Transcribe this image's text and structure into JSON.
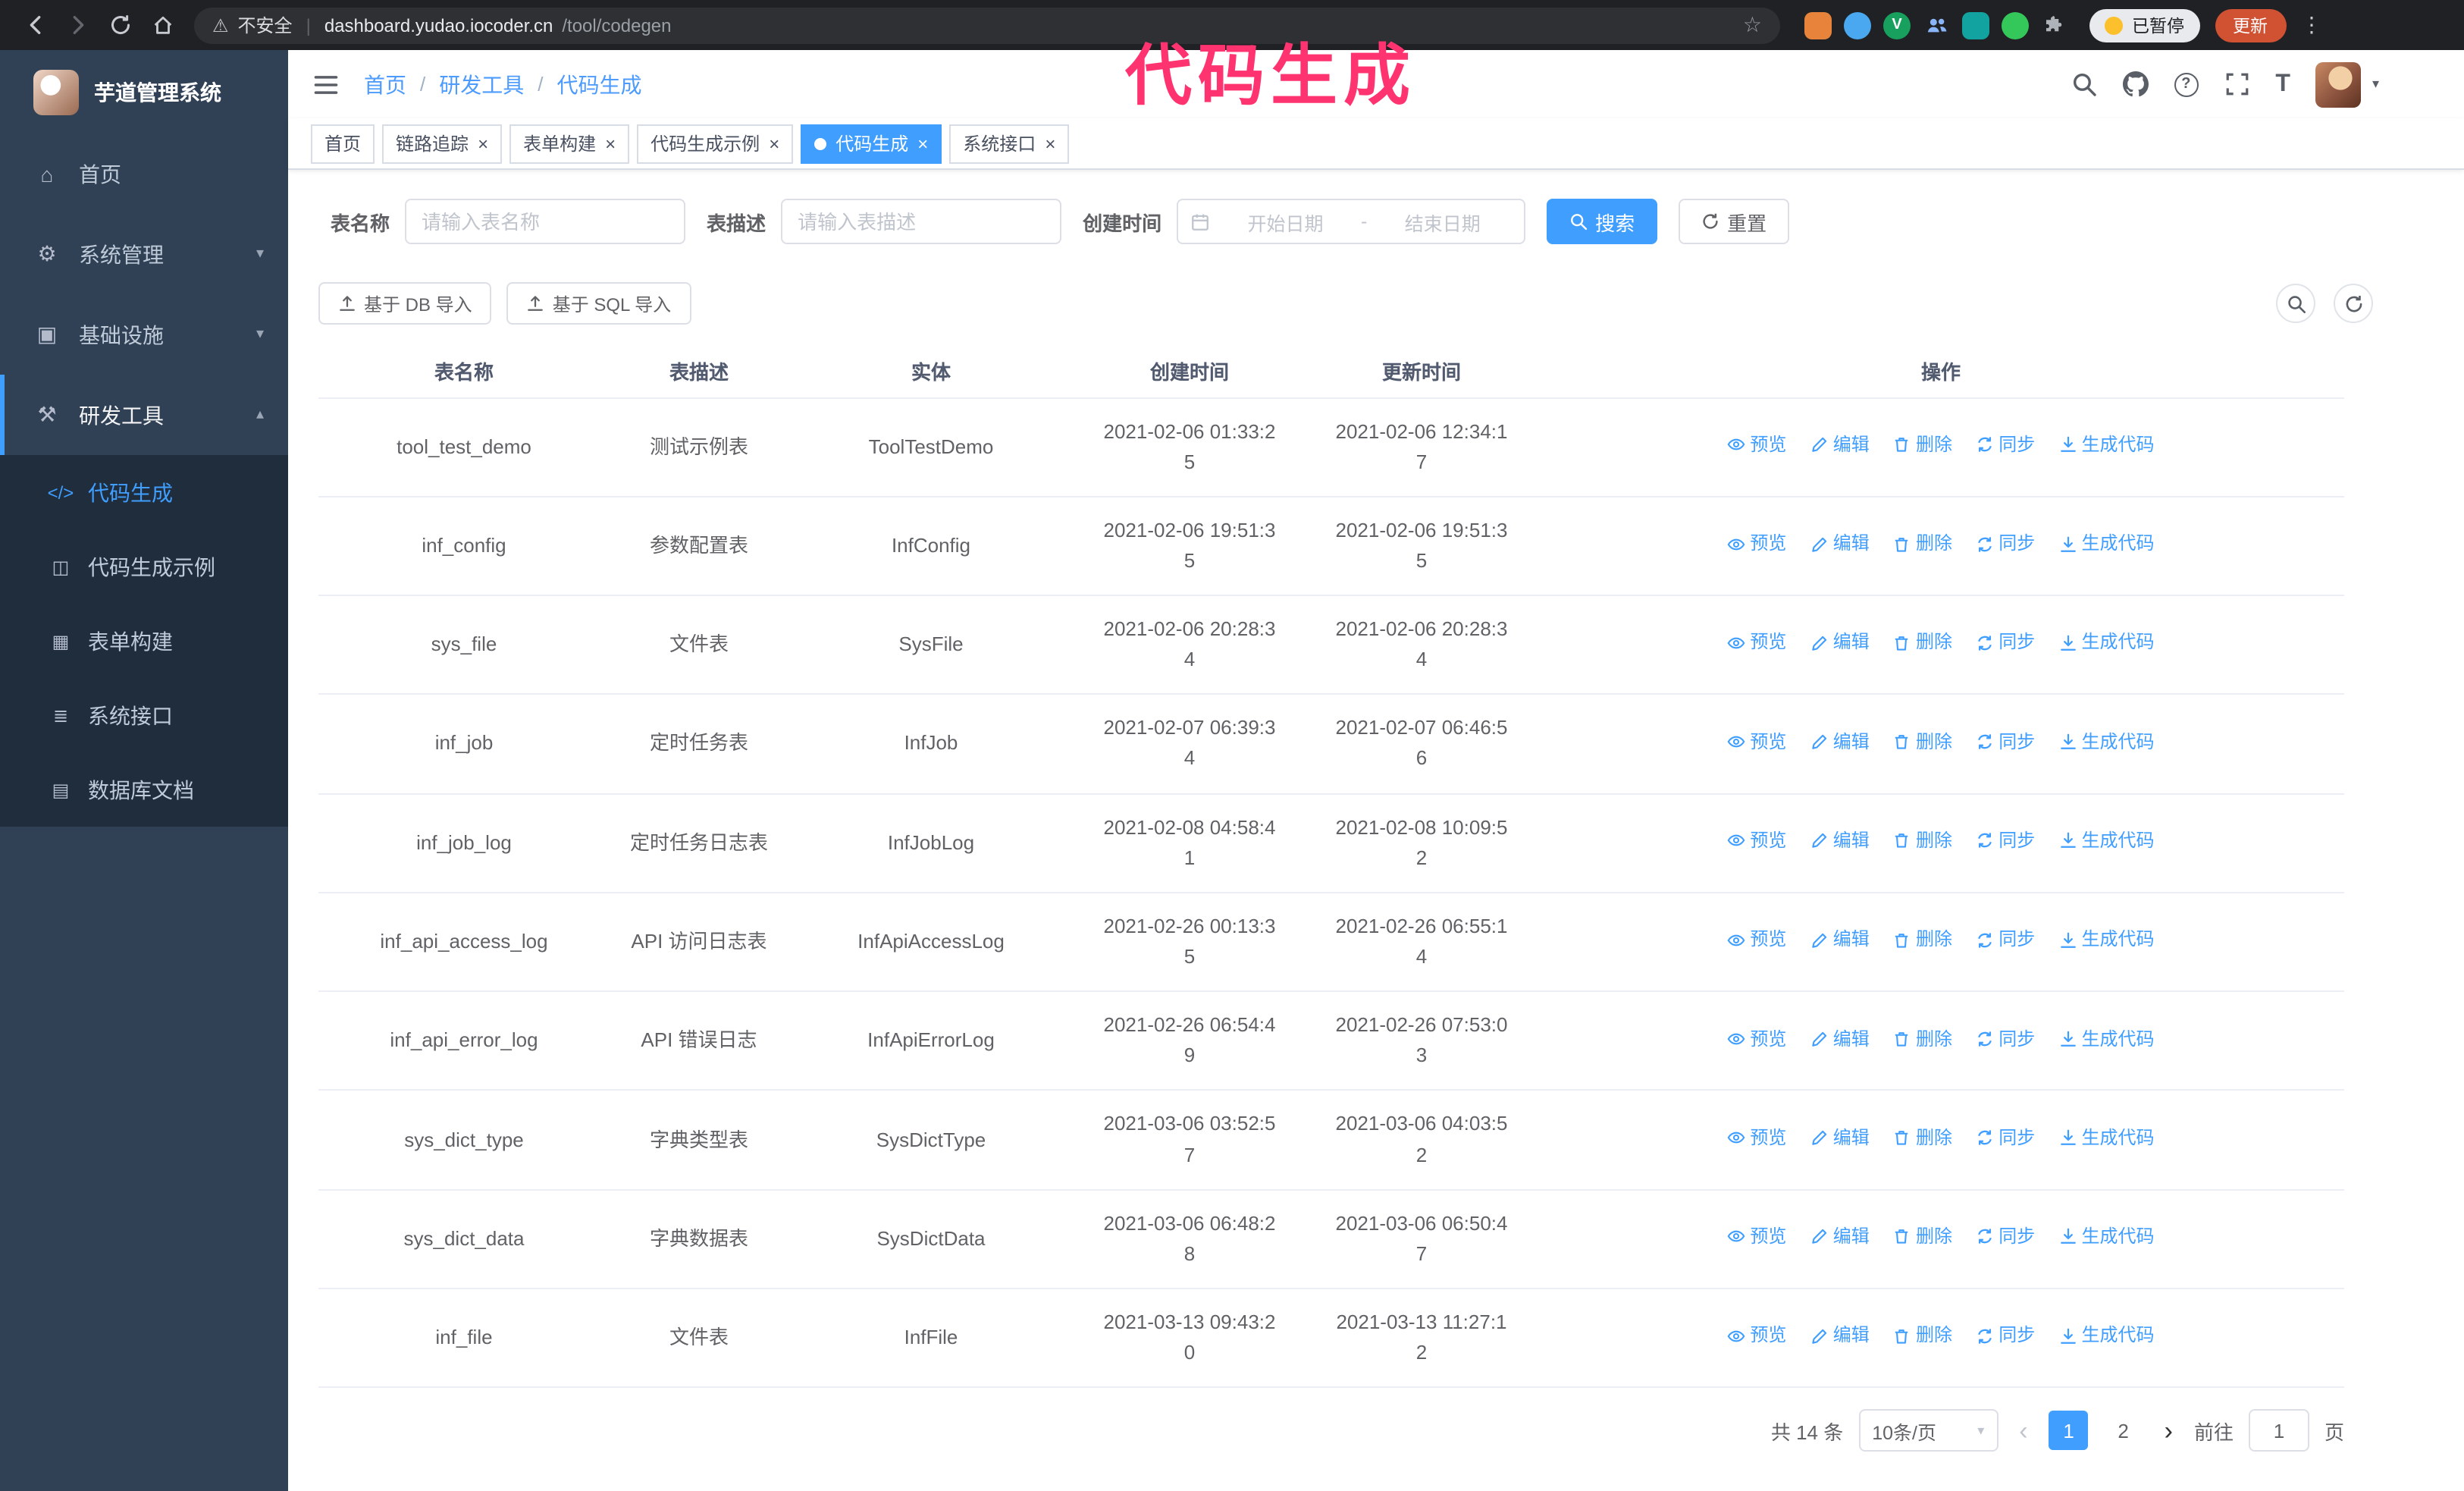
{
  "annotation": {
    "text": "代码生成",
    "color": "#ff3370"
  },
  "ui": {
    "close_glyph": "×",
    "caret_down": "▾",
    "dots_glyph": "⋮",
    "star_glyph": "☆",
    "warning_glyph": "⚠",
    "arrow_prev": "‹",
    "arrow_next": "›",
    "help_glyph": "?",
    "font_icon_glyph": "T"
  },
  "browser": {
    "insecure_label": "不安全",
    "url_host": "dashboard.yudao.iocoder.cn",
    "url_path": "/tool/codegen",
    "extension_badge_v": "V",
    "paused_badge": "已暂停",
    "update_button": "更新"
  },
  "sidebar": {
    "logo_title": "芋道管理系统",
    "items": [
      {
        "label": "首页",
        "icon": "⌂",
        "chevron": ""
      },
      {
        "label": "系统管理",
        "icon": "⚙",
        "chevron": "▾"
      },
      {
        "label": "基础设施",
        "icon": "▣",
        "chevron": "▾"
      },
      {
        "label": "研发工具",
        "icon": "⚒",
        "chevron": "▴"
      }
    ],
    "subitems": [
      {
        "label": "代码生成",
        "icon": "</>"
      },
      {
        "label": "代码生成示例",
        "icon": "◫"
      },
      {
        "label": "表单构建",
        "icon": "▦"
      },
      {
        "label": "系统接口",
        "icon": "≣"
      },
      {
        "label": "数据库文档",
        "icon": "▤"
      }
    ]
  },
  "header": {
    "breadcrumb": [
      "首页",
      "研发工具",
      "代码生成"
    ],
    "separator": "/"
  },
  "tabs": [
    {
      "label": "首页"
    },
    {
      "label": "链路追踪"
    },
    {
      "label": "表单构建"
    },
    {
      "label": "代码生成示例"
    },
    {
      "label": "代码生成"
    },
    {
      "label": "系统接口"
    }
  ],
  "filters": {
    "table_name_label": "表名称",
    "table_name_placeholder": "请输入表名称",
    "table_desc_label": "表描述",
    "table_desc_placeholder": "请输入表描述",
    "create_time_label": "创建时间",
    "date_start_placeholder": "开始日期",
    "date_separator": "-",
    "date_end_placeholder": "结束日期",
    "search_button": "搜索",
    "reset_button": "重置"
  },
  "toolbar": {
    "import_db": "基于 DB 导入",
    "import_sql": "基于 SQL 导入"
  },
  "table": {
    "columns": [
      "表名称",
      "表描述",
      "实体",
      "创建时间",
      "更新时间",
      "操作"
    ],
    "actions": [
      "预览",
      "编辑",
      "删除",
      "同步",
      "生成代码"
    ],
    "rows": [
      {
        "name": "tool_test_demo",
        "desc": "测试示例表",
        "entity": "ToolTestDemo",
        "created": "2021-02-06 01:33:25",
        "updated": "2021-02-06 12:34:17"
      },
      {
        "name": "inf_config",
        "desc": "参数配置表",
        "entity": "InfConfig",
        "created": "2021-02-06 19:51:35",
        "updated": "2021-02-06 19:51:35"
      },
      {
        "name": "sys_file",
        "desc": "文件表",
        "entity": "SysFile",
        "created": "2021-02-06 20:28:34",
        "updated": "2021-02-06 20:28:34"
      },
      {
        "name": "inf_job",
        "desc": "定时任务表",
        "entity": "InfJob",
        "created": "2021-02-07 06:39:34",
        "updated": "2021-02-07 06:46:56"
      },
      {
        "name": "inf_job_log",
        "desc": "定时任务日志表",
        "entity": "InfJobLog",
        "created": "2021-02-08 04:58:41",
        "updated": "2021-02-08 10:09:52"
      },
      {
        "name": "inf_api_access_log",
        "desc": "API 访问日志表",
        "entity": "InfApiAccessLog",
        "created": "2021-02-26 00:13:35",
        "updated": "2021-02-26 06:55:14"
      },
      {
        "name": "inf_api_error_log",
        "desc": "API 错误日志",
        "entity": "InfApiErrorLog",
        "created": "2021-02-26 06:54:49",
        "updated": "2021-02-26 07:53:03"
      },
      {
        "name": "sys_dict_type",
        "desc": "字典类型表",
        "entity": "SysDictType",
        "created": "2021-03-06 03:52:57",
        "updated": "2021-03-06 04:03:52"
      },
      {
        "name": "sys_dict_data",
        "desc": "字典数据表",
        "entity": "SysDictData",
        "created": "2021-03-06 06:48:28",
        "updated": "2021-03-06 06:50:47"
      },
      {
        "name": "inf_file",
        "desc": "文件表",
        "entity": "InfFile",
        "created": "2021-03-13 09:43:20",
        "updated": "2021-03-13 11:27:12"
      }
    ]
  },
  "pagination": {
    "total": "共 14 条",
    "page_size": "10条/页",
    "pages": [
      "1",
      "2"
    ],
    "goto_label": "前往",
    "goto_value": "1",
    "goto_suffix": "页"
  }
}
